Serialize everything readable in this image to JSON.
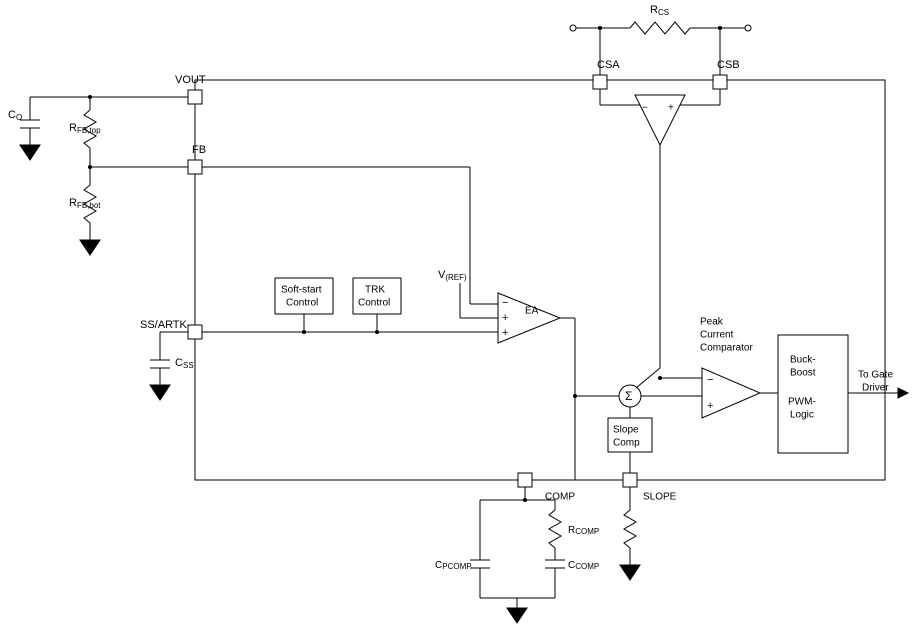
{
  "labels": {
    "rcs": "R",
    "rcs_sub": "CS",
    "csa": "CSA",
    "csb": "CSB",
    "vout": "VOUT",
    "co": "C",
    "co_sub": "O",
    "rfbtop": "R",
    "rfbtop_sub": "FB,top",
    "fb": "FB",
    "rfbbot": "R",
    "rfbbot_sub": "FB,bot",
    "softstart": "Soft-start Control",
    "trk": "TRK Control",
    "vref": "V",
    "vref_sub": "(REF)",
    "ea": "EA",
    "ssartk": "SS/ARTK",
    "css": "C",
    "css_sub": "SS",
    "peak": "Peak Current Comparator",
    "buckboost1": "Buck-",
    "buckboost2": "Boost",
    "pwmlogic": "PWM-Logic",
    "togate": "To Gate Driver",
    "sigma": "Σ",
    "slopecomp": "Slope Comp",
    "comp_pin": "COMP",
    "slope_pin": "SLOPE",
    "rcomp": "R",
    "rcomp_sub": "COMP",
    "cpcomp": "C",
    "cpcomp_sub": "PCOMP",
    "ccomp": "C",
    "ccomp_sub": "COMP",
    "plus": "+",
    "minus": "−"
  }
}
